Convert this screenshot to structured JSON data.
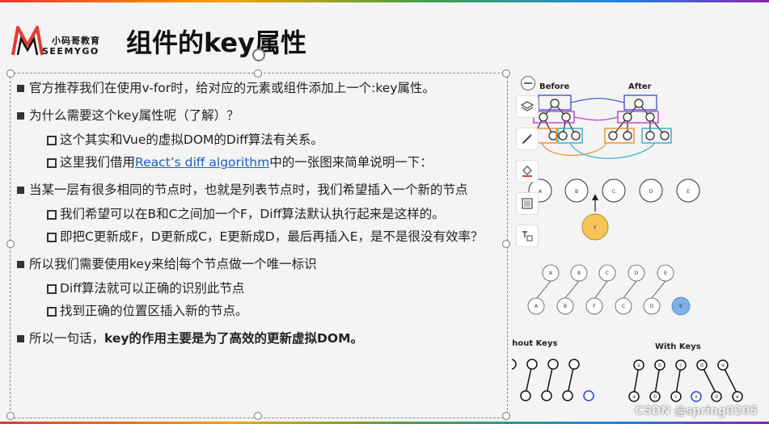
{
  "header": {
    "logo_cn": "小码哥教育",
    "logo_en": "SEEMYGO",
    "title": "组件的key属性"
  },
  "bullets": {
    "b1": "官方推荐我们在使用v-for时，给对应的元素或组件添加上一个:key属性。",
    "b2": "为什么需要这个key属性呢（了解）？",
    "b2_1": "这个其实和Vue的虚拟DOM的Diff算法有关系。",
    "b2_2_pre": "这里我们借用",
    "b2_2_link": "React’s diff algorithm",
    "b2_2_post": "中的一张图来简单说明一下：",
    "b3": "当某一层有很多相同的节点时，也就是列表节点时，我们希望插入一个新的节点",
    "b3_1": "我们希望可以在B和C之间加一个F，Diff算法默认执行起来是这样的。",
    "b3_2": "即把C更新成F，D更新成C，E更新成D，最后再插入E，是不是很没有效率？",
    "b4_pre": "所以我们需要使用key来给",
    "b4_post": "每个节点做一个唯一标识",
    "b4_1": "Diff算法就可以正确的识别此节点",
    "b4_2": "找到正确的位置区插入新的节点。",
    "b5_pre": "所以一句话，",
    "b5_bold": "key的作用主要是为了高效的更新虚拟DOM。"
  },
  "figure": {
    "before": "Before",
    "after": "After",
    "row1": [
      "A",
      "B",
      "C",
      "D",
      "E"
    ],
    "insert": "F",
    "row_top": [
      "A",
      "B",
      "C",
      "D",
      "E"
    ],
    "row_bottom": [
      "A",
      "B",
      "F",
      "C",
      "D",
      "E"
    ],
    "without_keys": "Without Keys",
    "with_keys": "With Keys",
    "with_keys_top": [
      "a",
      "b",
      "c",
      "d",
      "e"
    ],
    "with_keys_bottom": [
      "a",
      "b",
      "c",
      "x",
      "d",
      "e"
    ]
  },
  "watermark": "CSDN @spring0205",
  "colors": {
    "highlight_blue": "#7fb0e8",
    "highlight_orange": "#f6c55a",
    "link": "#1f5fbf"
  }
}
